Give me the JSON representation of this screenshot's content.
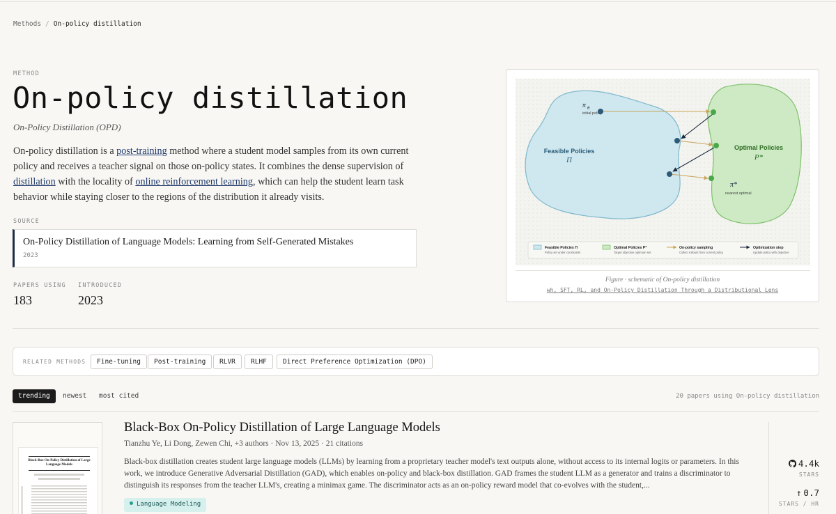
{
  "breadcrumb": {
    "parent": "Methods",
    "separator": "/",
    "current": "On-policy distillation"
  },
  "header": {
    "eyebrow": "METHOD",
    "title": "On-policy distillation",
    "subtitle": "On-Policy Distillation (OPD)"
  },
  "description": {
    "t1": "On-policy distillation is a ",
    "link1": "post-training",
    "t2": " method where a student model samples from its own current policy and receives a teacher signal on those on-policy states. It combines the dense supervision of ",
    "link2": "distillation",
    "t3": " with the locality of ",
    "link3": "online reinforcement learning",
    "t4": ", which can help the student learn task behavior while staying closer to the regions of the distribution it already visits."
  },
  "source": {
    "label": "SOURCE",
    "title": "On-Policy Distillation of Language Models: Learning from Self-Generated Mistakes",
    "year": "2023"
  },
  "stats": {
    "papers_label": "PAPERS USING",
    "papers_value": "183",
    "introduced_label": "INTRODUCED",
    "introduced_value": "2023"
  },
  "figure": {
    "caption": "Figure · schematic of On-policy distillation",
    "caption_link": "wh, SFT, RL, and On-Policy Distillation Through a Distributional Lens",
    "diagram": {
      "feasible_title": "Feasible Policies",
      "feasible_symbol": "Π",
      "optimal_title": "Optimal Policies",
      "optimal_symbol": "P*",
      "initial_symbol": "π",
      "initial_sub": "θ",
      "initial_label": "initial policy",
      "nearest_symbol": "π*",
      "nearest_label": "nearest optimal",
      "legend": [
        {
          "title": "Feasible Policies Π",
          "sub": "Policy set under constraints"
        },
        {
          "title": "Optimal Policies P*",
          "sub": "Target objective optimum set"
        },
        {
          "title": "On-policy sampling",
          "sub": "Collect rollouts from current policy"
        },
        {
          "title": "Optimization step",
          "sub": "Update policy with objective"
        }
      ],
      "colors": {
        "feasible_fill": "#cfe7ef",
        "feasible_stroke": "#7fb8cc",
        "optimal_fill": "#cdeac4",
        "optimal_stroke": "#7fc06c",
        "sampling_arrow": "#c9a45a",
        "step_arrow": "#1c2a3e"
      }
    }
  },
  "related": {
    "label": "RELATED METHODS",
    "items": [
      "Fine-tuning",
      "Post-training",
      "RLVR",
      "RLHF",
      "Direct Preference Optimization (DPO)"
    ]
  },
  "sort_tabs": [
    "trending",
    "newest",
    "most cited"
  ],
  "paper_count": "20 papers using On-policy distillation",
  "papers": [
    {
      "title": "Black-Box On-Policy Distillation of Large Language Models",
      "meta": "Tianzhu Ye, Li Dong, Zewen Chi, +3 authors · Nov 13, 2025 · 21 citations",
      "abstract": "Black-box distillation creates student large language models (LLMs) by learning from a proprietary teacher model's text outputs alone, without access to its internal logits or parameters. In this work, we introduce Generative Adversarial Distillation (GAD), which enables on-policy and black-box distillation. GAD frames the student LLM as a generator and trains a discriminator to distinguish its responses from the teacher LLM's, creating a minimax game. The discriminator acts as an on-policy reward model that co-evolves with the student,...",
      "tag": "Language Modeling",
      "stars": "4.4k",
      "stars_label": "STARS",
      "stars_hr": "0.7",
      "stars_hr_label": "STARS / HR",
      "thumb_title": "Black-Box On-Policy Distillation of Large Language Models"
    }
  ]
}
